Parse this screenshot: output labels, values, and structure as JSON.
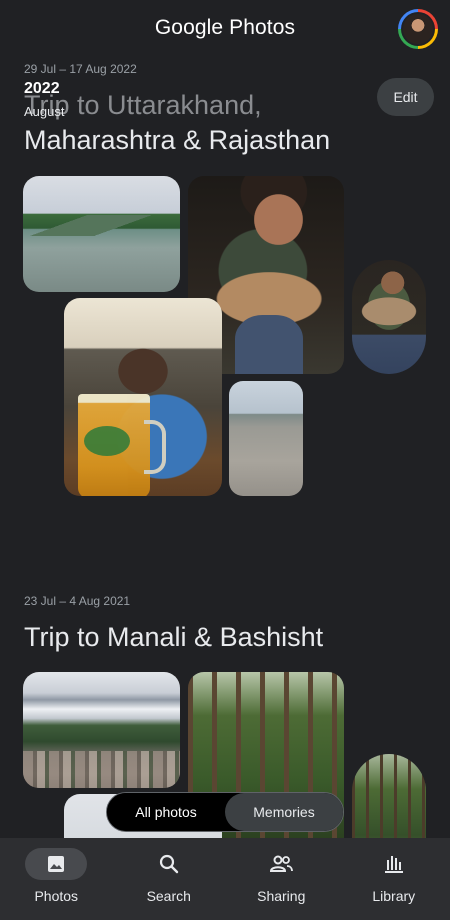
{
  "app": {
    "brand_google": "Google",
    "brand_photos": "Photos"
  },
  "sections": [
    {
      "date_range": "29 Jul – 17 Aug 2022",
      "title_line1": "Trip to Uttarakhand,",
      "title_line2": "Maharashtra & Rajasthan",
      "edit_label": "Edit"
    },
    {
      "date_range": "23 Jul – 4 Aug 2021",
      "title_line1": "Trip to Manali & Bashisht"
    }
  ],
  "scroll_overlay": {
    "year": "2022",
    "month": "August"
  },
  "view_toggle": {
    "options": [
      "All photos",
      "Memories"
    ],
    "selected": "All photos"
  },
  "bottom_nav": [
    {
      "label": "Photos",
      "icon": "photo-icon",
      "active": true
    },
    {
      "label": "Search",
      "icon": "search-icon",
      "active": false
    },
    {
      "label": "Sharing",
      "icon": "people-icon",
      "active": false
    },
    {
      "label": "Library",
      "icon": "library-icon",
      "active": false
    }
  ],
  "colors": {
    "background": "#202124",
    "nav_bg": "#2d2e31",
    "text": "#e8eaed",
    "muted": "#9aa0a6"
  }
}
